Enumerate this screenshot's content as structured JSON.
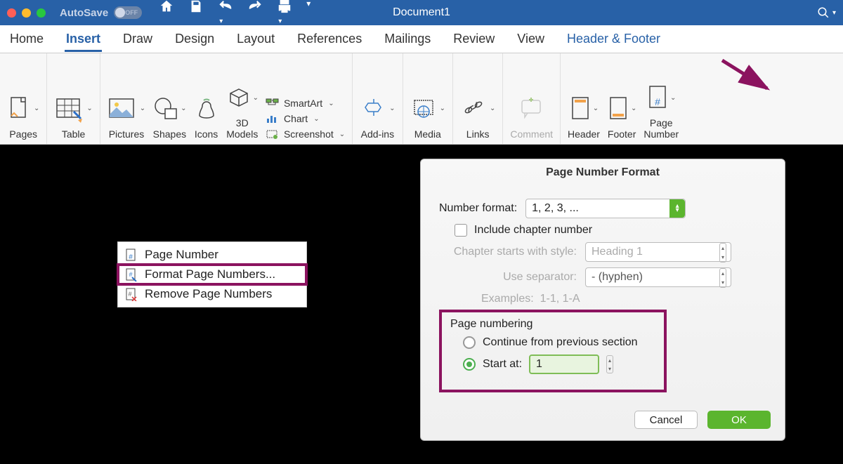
{
  "titlebar": {
    "autosave_label": "AutoSave",
    "autosave_state": "OFF",
    "doc_title": "Document1"
  },
  "tabs": [
    "Home",
    "Insert",
    "Draw",
    "Design",
    "Layout",
    "References",
    "Mailings",
    "Review",
    "View",
    "Header & Footer"
  ],
  "active_tab": "Insert",
  "context_tab": "Header & Footer",
  "ribbon": {
    "pages": "Pages",
    "table": "Table",
    "pictures": "Pictures",
    "shapes": "Shapes",
    "icons": "Icons",
    "models": "3D\nModels",
    "smartart": "SmartArt",
    "chart": "Chart",
    "screenshot": "Screenshot",
    "addins": "Add-ins",
    "media": "Media",
    "links": "Links",
    "comment": "Comment",
    "header": "Header",
    "footer": "Footer",
    "page_number": "Page\nNumber"
  },
  "context_menu": {
    "items": [
      {
        "icon": "page-number-icon",
        "label": "Page Number"
      },
      {
        "icon": "format-page-numbers-icon",
        "label": "Format Page Numbers..."
      },
      {
        "icon": "remove-page-numbers-icon",
        "label": "Remove Page Numbers"
      }
    ],
    "highlight_index": 1
  },
  "dialog": {
    "title": "Page Number Format",
    "number_format_label": "Number format:",
    "number_format_value": "1, 2, 3, ...",
    "include_chapter": "Include chapter number",
    "chapter_starts_label": "Chapter starts with style:",
    "chapter_starts_value": "Heading 1",
    "separator_label": "Use separator:",
    "separator_value": "-     (hyphen)",
    "examples_label": "Examples:",
    "examples_value": "1-1, 1-A",
    "page_numbering_label": "Page numbering",
    "continue_label": "Continue from previous section",
    "start_at_label": "Start at:",
    "start_at_value": "1",
    "cancel": "Cancel",
    "ok": "OK"
  }
}
